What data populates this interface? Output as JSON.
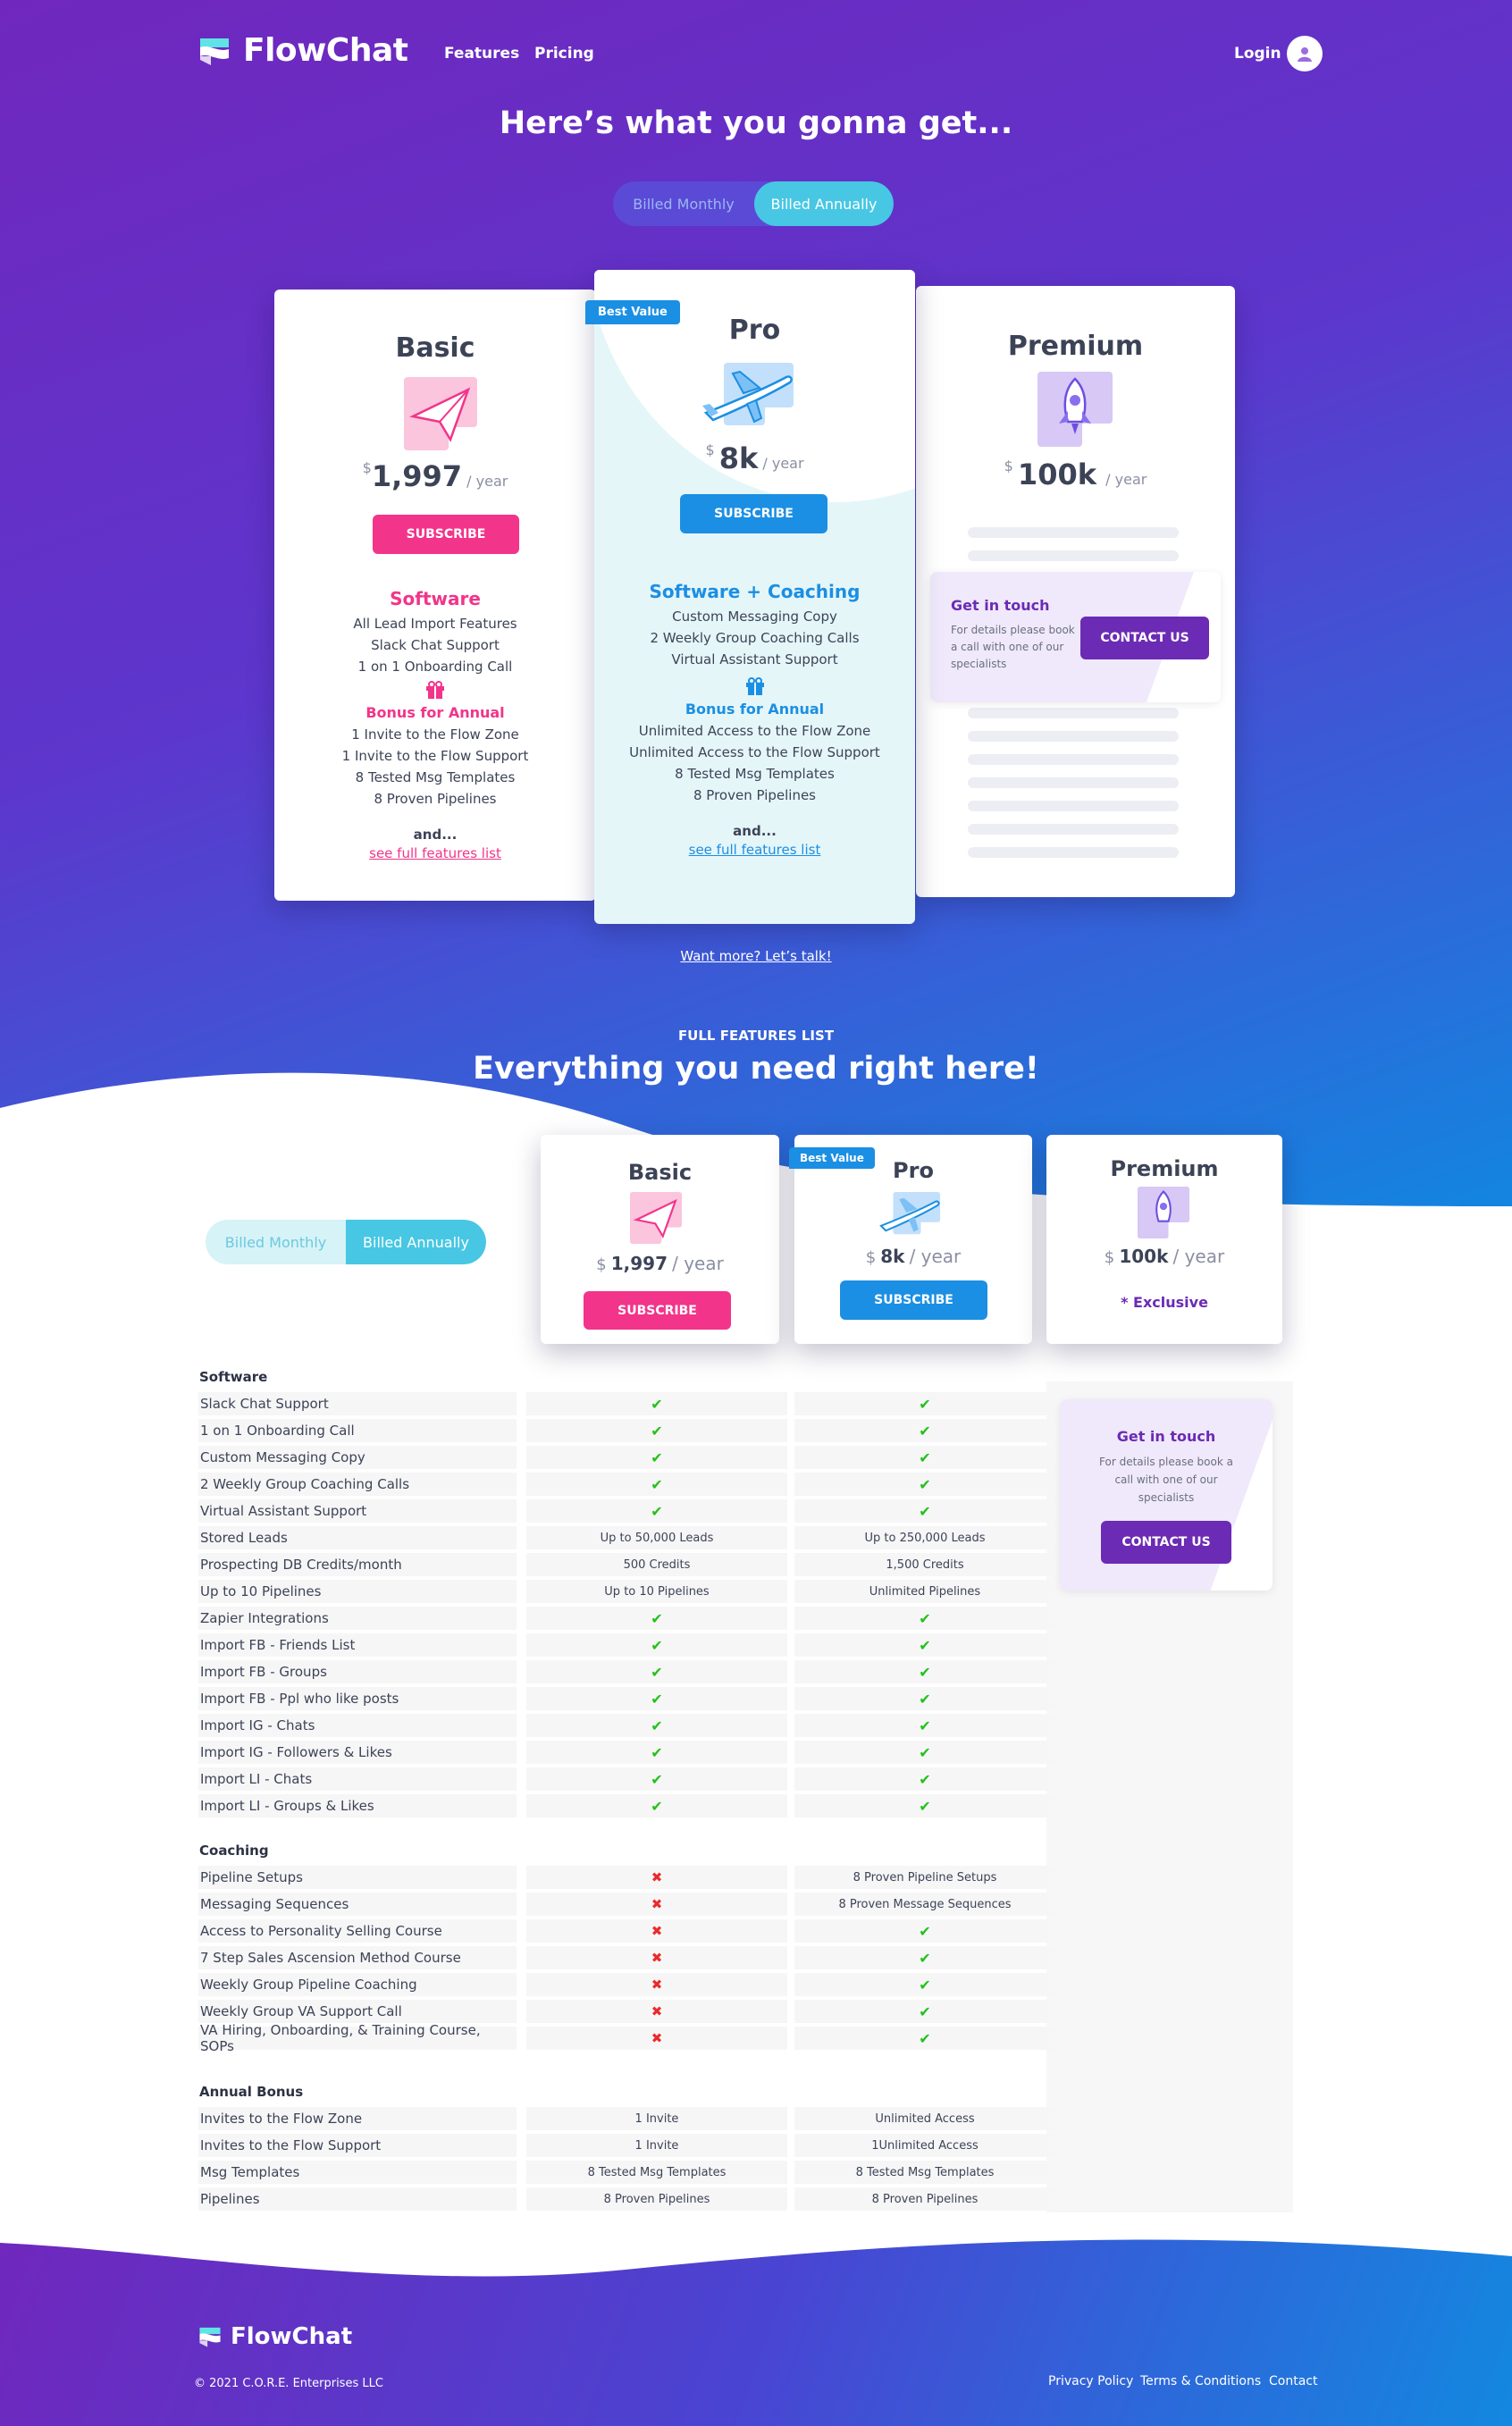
{
  "brand": {
    "name": "FlowChat",
    "accent": "#1b8fe3",
    "pink": "#f2348a",
    "purple": "#6b2bb4"
  },
  "nav": {
    "features": "Features",
    "pricing": "Pricing",
    "login": "Login"
  },
  "hero": {
    "title": "Here’s what you gonna get...",
    "toggle_monthly": "Billed Monthly",
    "toggle_annually": "Billed Annually"
  },
  "plans": {
    "basic": {
      "name": "Basic",
      "currency": "$",
      "price": "1,997",
      "period": "/ year",
      "button": "SUBSCRIBE",
      "section": "Software",
      "features": [
        "All Lead Import Features",
        "Slack Chat Support",
        "1 on 1 Onboarding Call"
      ],
      "bonus_title": "Bonus for Annual",
      "bonus": [
        "1 Invite to the Flow Zone",
        "1 Invite to the Flow Support",
        "8 Tested Msg Templates",
        "8 Proven Pipelines"
      ],
      "and": "and...",
      "full_link": "see full features list"
    },
    "pro": {
      "name": "Pro",
      "ribbon": "Best Value",
      "currency": "$",
      "price": "8k",
      "period": "/ year",
      "button": "SUBSCRIBE",
      "section": "Software + Coaching",
      "features": [
        "Custom Messaging Copy",
        "2 Weekly Group Coaching Calls",
        "Virtual Assistant Support"
      ],
      "bonus_title": "Bonus for Annual",
      "bonus": [
        "Unlimited Access to the Flow Zone",
        "Unlimited Access to the Flow Support",
        "8 Tested Msg Templates",
        "8 Proven Pipelines"
      ],
      "and": "and...",
      "full_link": "see full features list"
    },
    "premium": {
      "name": "Premium",
      "currency": "$",
      "price": "100k",
      "period": "/ year",
      "contact_title": "Get in touch",
      "contact_text": "For details please book a call with one of our specialists",
      "contact_button": "CONTACT US"
    }
  },
  "want_more": "Want more? Let’s talk!",
  "features_section": {
    "eyebrow": "FULL FEATURES LIST",
    "title": "Everything you need right here!",
    "toggle_monthly": "Billed Monthly",
    "toggle_annually": "Billed Annually",
    "basic": {
      "name": "Basic",
      "currency": "$",
      "price": "1,997",
      "period": "/ year",
      "button": "SUBSCRIBE"
    },
    "pro": {
      "name": "Pro",
      "ribbon": "Best Value",
      "currency": "$",
      "price": "8k",
      "period": "/ year",
      "button": "SUBSCRIBE"
    },
    "premium": {
      "name": "Premium",
      "currency": "$",
      "price": "100k",
      "period": "/ year",
      "exclusive": "* Exclusive",
      "contact_title": "Get in touch",
      "contact_text": "For details please book a call with one of our specialists",
      "contact_button": "CONTACT US"
    }
  },
  "table": {
    "software": {
      "title": "Software",
      "rows": [
        {
          "label": "Slack Chat Support",
          "basic": "check",
          "pro": "check"
        },
        {
          "label": "1 on 1 Onboarding Call",
          "basic": "check",
          "pro": "check"
        },
        {
          "label": "Custom Messaging Copy",
          "basic": "check",
          "pro": "check"
        },
        {
          "label": "2 Weekly Group Coaching Calls",
          "basic": "check",
          "pro": "check"
        },
        {
          "label": "Virtual Assistant Support",
          "basic": "check",
          "pro": "check"
        },
        {
          "label": "Stored Leads",
          "basic": "Up to 50,000 Leads",
          "pro": "Up to 250,000 Leads"
        },
        {
          "label": "Prospecting DB Credits/month",
          "basic": "500 Credits",
          "pro": "1,500 Credits"
        },
        {
          "label": "Up to 10 Pipelines",
          "basic": "Up to 10 Pipelines",
          "pro": "Unlimited Pipelines"
        },
        {
          "label": "Zapier Integrations",
          "basic": "check",
          "pro": "check"
        },
        {
          "label": "Import FB - Friends List",
          "basic": "check",
          "pro": "check"
        },
        {
          "label": "Import FB - Groups",
          "basic": "check",
          "pro": "check"
        },
        {
          "label": "Import FB - Ppl who like posts",
          "basic": "check",
          "pro": "check"
        },
        {
          "label": "Import IG - Chats",
          "basic": "check",
          "pro": "check"
        },
        {
          "label": "Import IG - Followers & Likes",
          "basic": "check",
          "pro": "check"
        },
        {
          "label": "Import LI - Chats",
          "basic": "check",
          "pro": "check"
        },
        {
          "label": "Import LI - Groups & Likes",
          "basic": "check",
          "pro": "check"
        }
      ]
    },
    "coaching": {
      "title": "Coaching",
      "rows": [
        {
          "label": "Pipeline Setups",
          "basic": "cross",
          "pro": "8 Proven Pipeline Setups"
        },
        {
          "label": "Messaging Sequences",
          "basic": "cross",
          "pro": "8 Proven Message Sequences"
        },
        {
          "label": "Access to Personality Selling Course",
          "basic": "cross",
          "pro": "check"
        },
        {
          "label": "7 Step Sales Ascension Method Course",
          "basic": "cross",
          "pro": "check"
        },
        {
          "label": "Weekly Group Pipeline Coaching",
          "basic": "cross",
          "pro": "check"
        },
        {
          "label": "Weekly Group VA Support Call",
          "basic": "cross",
          "pro": "check"
        },
        {
          "label": "VA Hiring, Onboarding, & Training Course, SOPs",
          "basic": "cross",
          "pro": "check"
        }
      ]
    },
    "bonus": {
      "title": "Annual Bonus",
      "rows": [
        {
          "label": "Invites to the Flow Zone",
          "basic": "1 Invite",
          "pro": "Unlimited Access"
        },
        {
          "label": "Invites to the Flow Support",
          "basic": "1 Invite",
          "pro": "1Unlimited Access"
        },
        {
          "label": "Msg Templates",
          "basic": "8 Tested Msg Templates",
          "pro": "8 Tested Msg Templates"
        },
        {
          "label": "Pipelines",
          "basic": "8 Proven Pipelines",
          "pro": "8 Proven Pipelines"
        }
      ]
    }
  },
  "footer": {
    "brand": "FlowChat",
    "copyright": "© 2021 C.O.R.E. Enterprises LLC",
    "privacy": "Privacy Policy",
    "terms": "Terms & Conditions",
    "contact": "Contact"
  }
}
